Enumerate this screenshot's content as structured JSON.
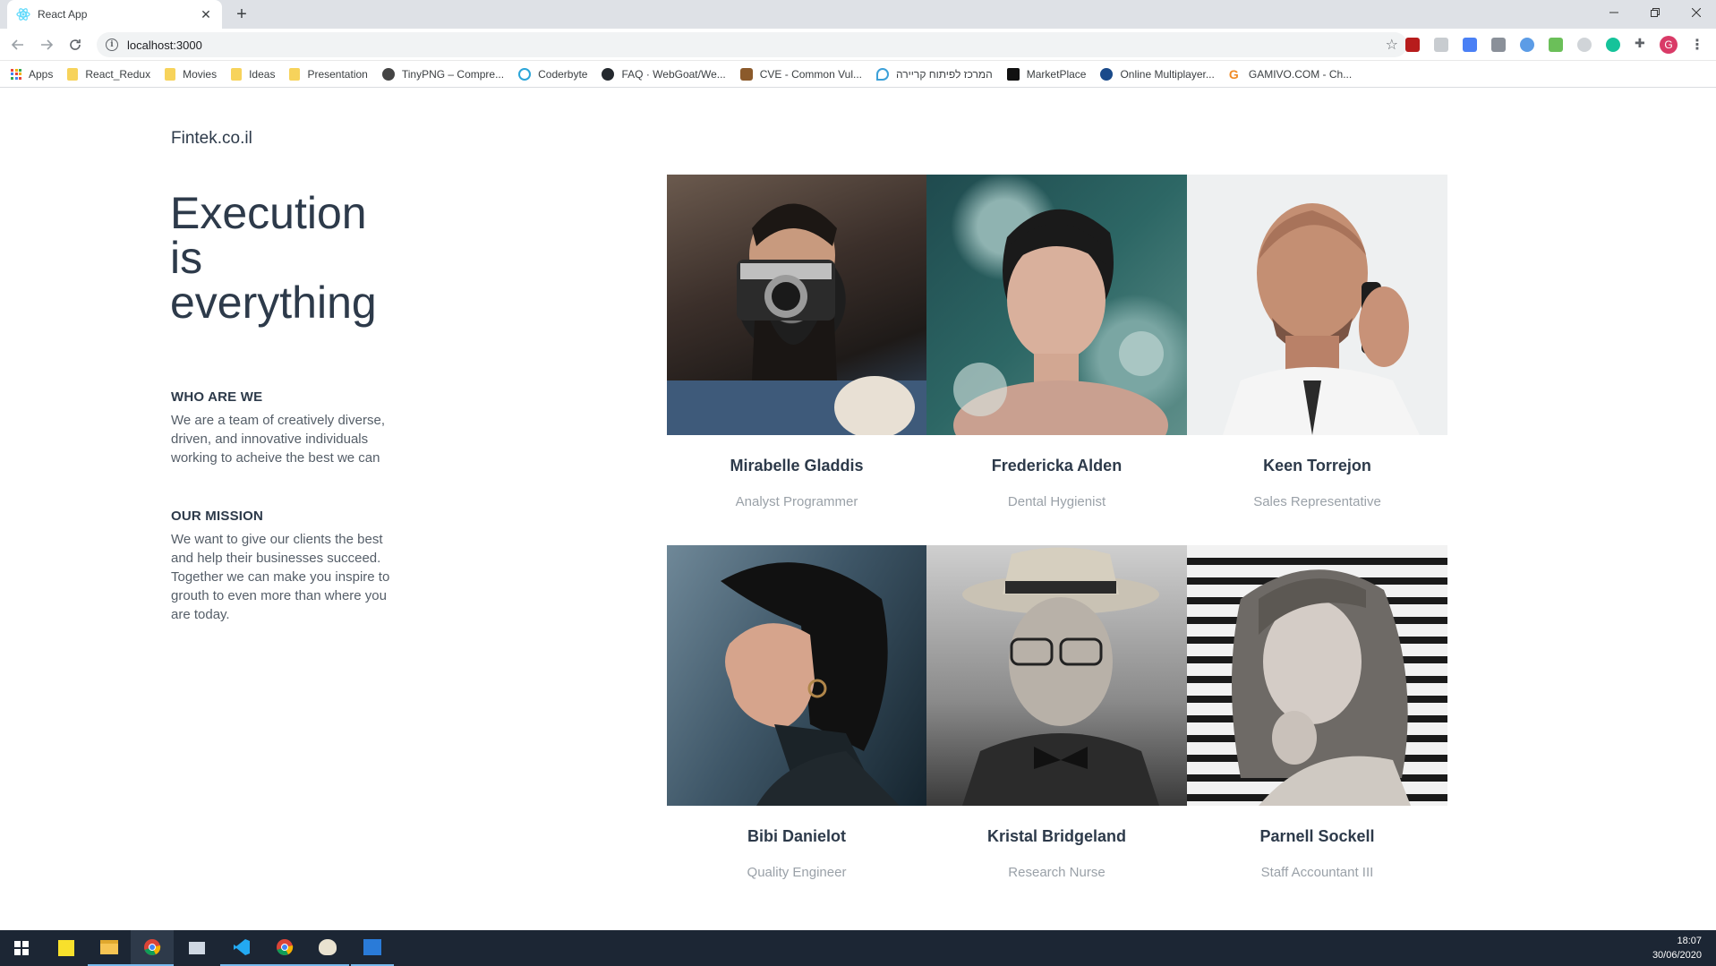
{
  "browser": {
    "tab_title": "React App",
    "url": "localhost:3000",
    "bookmarks": [
      {
        "label": "Apps",
        "icon": "apps-grid-icon"
      },
      {
        "label": "React_Redux",
        "icon": "folder-icon"
      },
      {
        "label": "Movies",
        "icon": "folder-icon"
      },
      {
        "label": "Ideas",
        "icon": "folder-icon"
      },
      {
        "label": "Presentation",
        "icon": "folder-icon"
      },
      {
        "label": "TinyPNG – Compre...",
        "icon": "panda-icon"
      },
      {
        "label": "Coderbyte",
        "icon": "coderbyte-icon"
      },
      {
        "label": "FAQ · WebGoat/We...",
        "icon": "github-icon"
      },
      {
        "label": "CVE - Common Vul...",
        "icon": "cve-icon"
      },
      {
        "label": "המרכז לפיתוח קריירה",
        "icon": "career-center-icon"
      },
      {
        "label": "MarketPlace",
        "icon": "marketplace-icon"
      },
      {
        "label": "Online Multiplayer...",
        "icon": "multiplayer-icon"
      },
      {
        "label": "GAMIVO.COM - Ch...",
        "icon": "gamivo-icon"
      }
    ],
    "profile_initial": "G",
    "colors": {
      "tabstrip": "#dee1e6",
      "omnibox": "#f1f3f4",
      "avatar": "#d93a67"
    }
  },
  "site": {
    "brand": "Fintek.co.il",
    "hero_lines": [
      "Execution",
      "is",
      "everything"
    ],
    "who": {
      "heading": "WHO ARE WE",
      "body": "We are a team of creatively diverse, driven, and innovative individuals working to acheive the best we can"
    },
    "mission": {
      "heading": "OUR MISSION",
      "body": "We want to give our clients the best and help their businesses succeed. Together we can make you inspire to grouth to even more than where you are today."
    },
    "team": [
      {
        "name": "Mirabelle Gladdis",
        "role": "Analyst Programmer"
      },
      {
        "name": "Fredericka Alden",
        "role": "Dental Hygienist"
      },
      {
        "name": "Keen Torrejon",
        "role": "Sales Representative"
      },
      {
        "name": "Bibi Danielot",
        "role": "Quality Engineer"
      },
      {
        "name": "Kristal Bridgeland",
        "role": "Research Nurse"
      },
      {
        "name": "Parnell Sockell",
        "role": "Staff Accountant III"
      }
    ],
    "colors": {
      "heading": "#2d3a4a",
      "body": "#555e68",
      "muted": "#9aa1a8"
    }
  },
  "taskbar": {
    "time": "18:07",
    "date": "30/06/2020",
    "apps": [
      "start-icon",
      "sticky-notes-icon",
      "file-explorer-icon",
      "chrome-icon",
      "store-icon",
      "vscode-icon",
      "chrome-icon",
      "paint-icon",
      "photos-icon"
    ]
  }
}
